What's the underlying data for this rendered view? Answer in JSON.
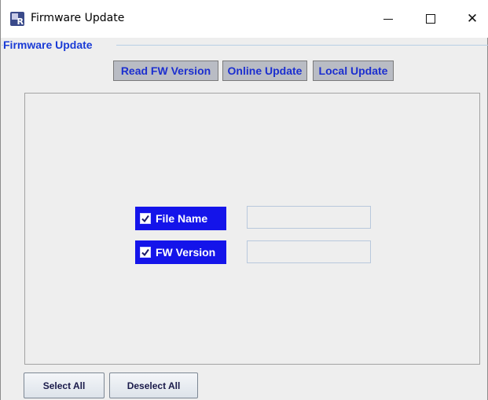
{
  "window": {
    "title": "Firmware Update",
    "icon_letter": "R",
    "controls": {
      "minimize": "minimize-icon",
      "maximize": "maximize-icon",
      "close": "close-icon"
    }
  },
  "group": {
    "title": "Firmware Update"
  },
  "toolbar": {
    "read_fw_version": "Read FW Version",
    "online_update": "Online Update",
    "local_update": "Local Update"
  },
  "fields": [
    {
      "label": "File Name",
      "checked": true,
      "value": ""
    },
    {
      "label": "FW Version",
      "checked": true,
      "value": ""
    }
  ],
  "footer": {
    "select_all": "Select All",
    "deselect_all": "Deselect All"
  },
  "colors": {
    "accent_blue": "#1414ea",
    "title_blue": "#1a3bd6",
    "button_gray": "#b9bcc4",
    "background": "#eeeeee"
  }
}
